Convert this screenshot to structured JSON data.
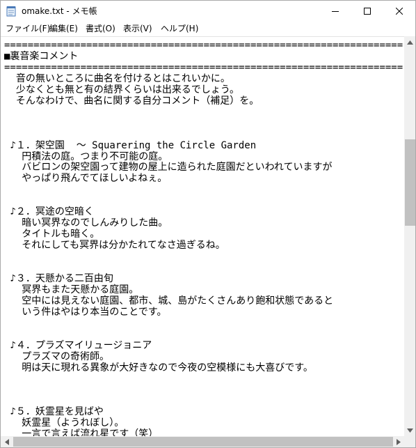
{
  "window": {
    "title": "omake.txt - メモ帳"
  },
  "menu": [
    "ファイル(F)",
    "編集(E)",
    "書式(O)",
    "表示(V)",
    "ヘルプ(H)"
  ],
  "lines": [
    "====================================================================",
    "■裏音楽コメント",
    "====================================================================",
    "  音の無いところに曲名を付けるとはこれいかに。",
    "  少なくとも無と有の結界くらいは出来るでしょう。",
    "  そんなわけで、曲名に関する自分コメント（補足）を。",
    "",
    "",
    "",
    " ♪１．架空園  ～ Squarering the Circle Garden",
    "   円積法の庭。つまり不可能の庭。",
    "   バビロンの架空園って建物の屋上に造られた庭園だといわれていますが",
    "   やっぱり飛んでてほしいよねぇ。",
    "",
    "",
    " ♪２．冥途の空暗く",
    "   暗い冥界なのでしんみりした曲。",
    "   タイトルも暗く。",
    "   それにしても冥界は分かたれてなさ過ぎるね。",
    "",
    "",
    " ♪３．天懸かる二百由旬",
    "   冥界もまた天懸かる庭園。",
    "   空中には見えない庭園、都市、城、島がたくさんあり飽和状態であると",
    "   いう件はやはり本当のことです。",
    "",
    "",
    " ♪４．プラズマイリュージョニア",
    "   プラズマの奇術師。",
    "   明は天に現れる異象が大好きなので今夜の空模様にも大喜びです。",
    "",
    "",
    "",
    " ♪５．妖霊星を見ばや",
    "   妖霊星（ようれぼし）。",
    "   一言で言えば流れ星です（笑）"
  ]
}
